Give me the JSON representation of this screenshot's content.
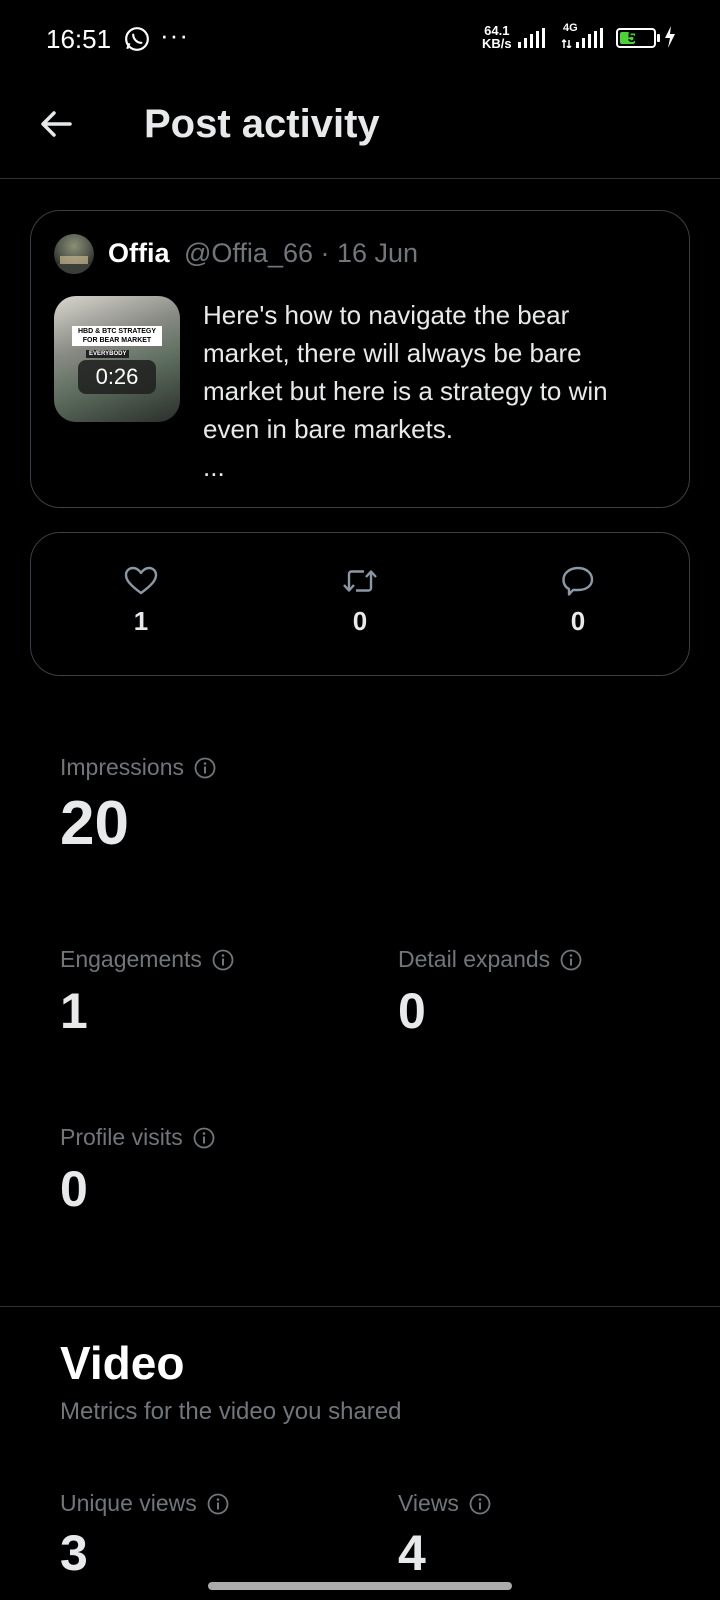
{
  "status_bar": {
    "time": "16:51",
    "more": "···",
    "net_speed_value": "64.1",
    "net_speed_unit": "KB/s",
    "network_type": "4G",
    "battery": "54",
    "battery_level": 0.54,
    "battery_color": "#4cd137"
  },
  "header": {
    "back_icon": "arrow-left-icon",
    "title": "Post activity"
  },
  "post": {
    "author_name": "Offia",
    "handle_date": "@Offia_66 · 16 Jun",
    "thumbnail_banner": "HBD & BTC STRATEGY FOR BEAR MARKET",
    "thumbnail_caption": "EVERYBODY",
    "video_duration": "0:26",
    "text": "Here's how to navigate the bear market, there will always be bare market but here is a strategy to win even in bare markets.",
    "ellipsis": "..."
  },
  "engagement": {
    "likes": "1",
    "reposts": "0",
    "replies": "0"
  },
  "metrics": {
    "impressions_label": "Impressions",
    "impressions_value": "20",
    "engagements_label": "Engagements",
    "engagements_value": "1",
    "detail_expands_label": "Detail expands",
    "detail_expands_value": "0",
    "profile_visits_label": "Profile visits",
    "profile_visits_value": "0"
  },
  "video": {
    "title": "Video",
    "subtitle": "Metrics for the video you shared",
    "unique_views_label": "Unique views",
    "unique_views_value": "3",
    "views_label": "Views",
    "views_value": "4"
  },
  "colors": {
    "background": "#000000",
    "text_primary": "#e7e9ea",
    "text_secondary": "#71767b",
    "border": "#3a3f44"
  }
}
